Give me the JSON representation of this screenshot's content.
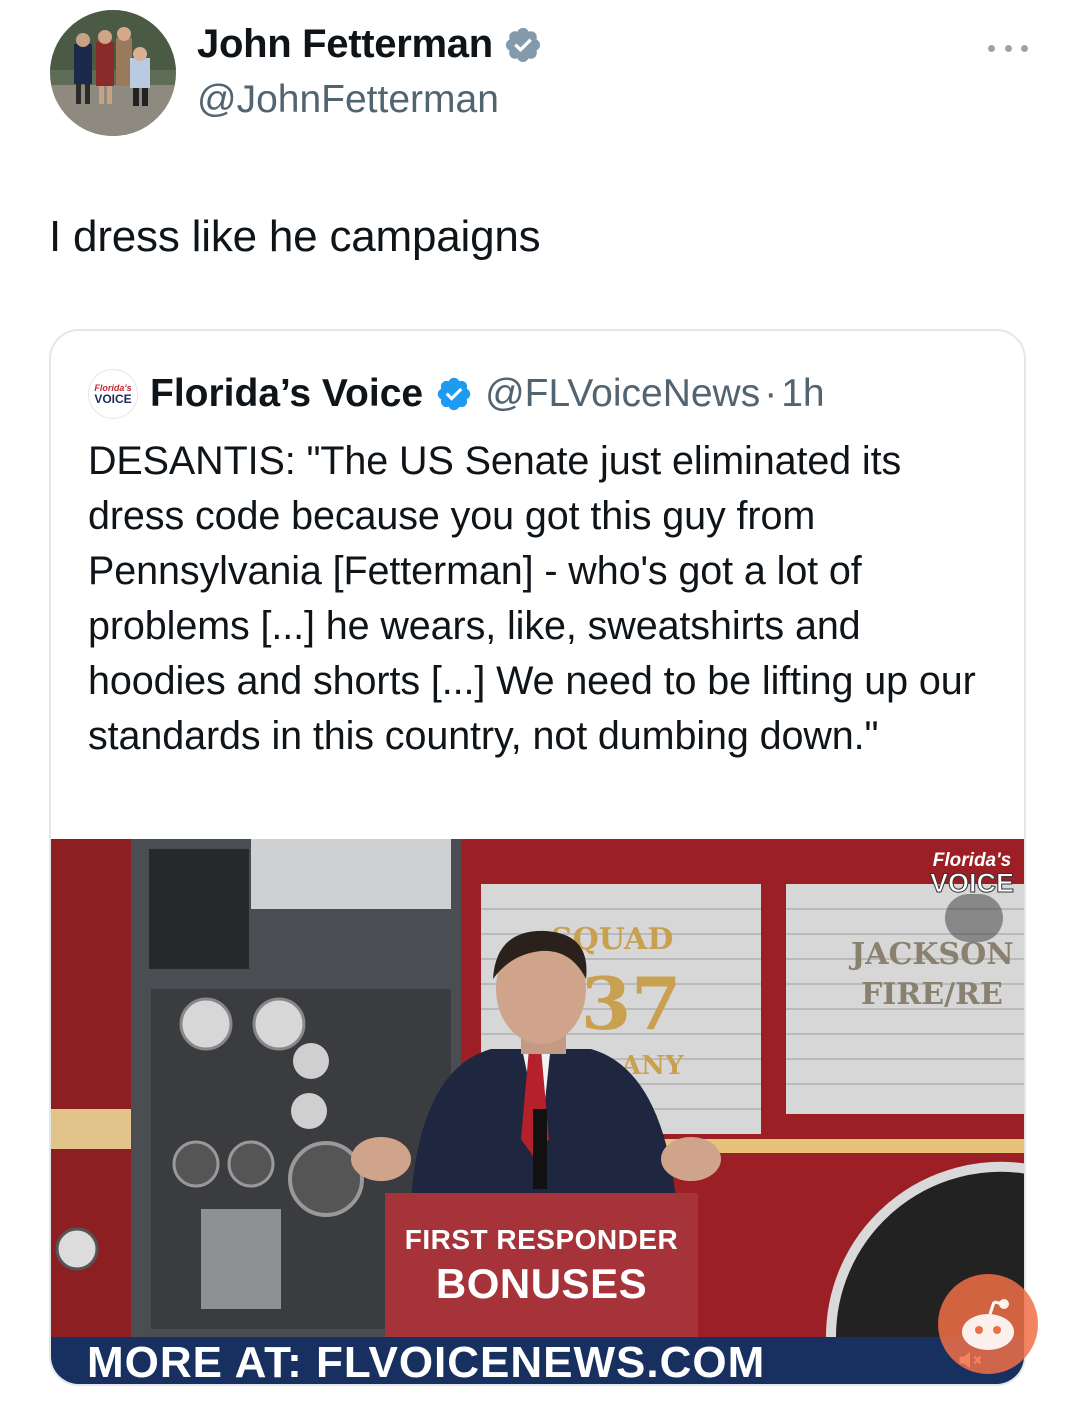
{
  "tweet": {
    "author_name": "John Fetterman",
    "author_handle": "@JohnFetterman",
    "text": "I dress like he campaigns",
    "verified_color": "#829aab"
  },
  "quoted": {
    "logo_line1": "Florida's",
    "logo_line2": "VOICE",
    "name": "Florida’s Voice",
    "handle": "@FLVoiceNews",
    "separator": "·",
    "time": "1h",
    "text": "DESANTIS: \"The US Senate just eliminated its dress code because you got this guy from Pennsylvania [Fetterman] - who's got a lot of problems [...] he wears, like, sweatshirts and hoodies and shorts [...] We need to be lifting up our standards in this country, not dumbing down.\"",
    "verified_color": "#1d9bf0"
  },
  "media": {
    "sign_line1": "FIRST RESPONDER",
    "sign_line2": "BONUSES",
    "banner": "MORE AT: FLVOICENEWS.COM",
    "truck_text_1": "SQUAD",
    "truck_number": "37",
    "truck_text_2": "ANY",
    "truck_text_3": "JACKSON",
    "truck_text_4": "FIRE/RE",
    "watermark_line1": "Florida's",
    "watermark_line2": "VOICE",
    "colors": {
      "truck_red": "#9b1f24",
      "banner_blue": "#17305f",
      "sign_red": "#a6333a"
    }
  }
}
